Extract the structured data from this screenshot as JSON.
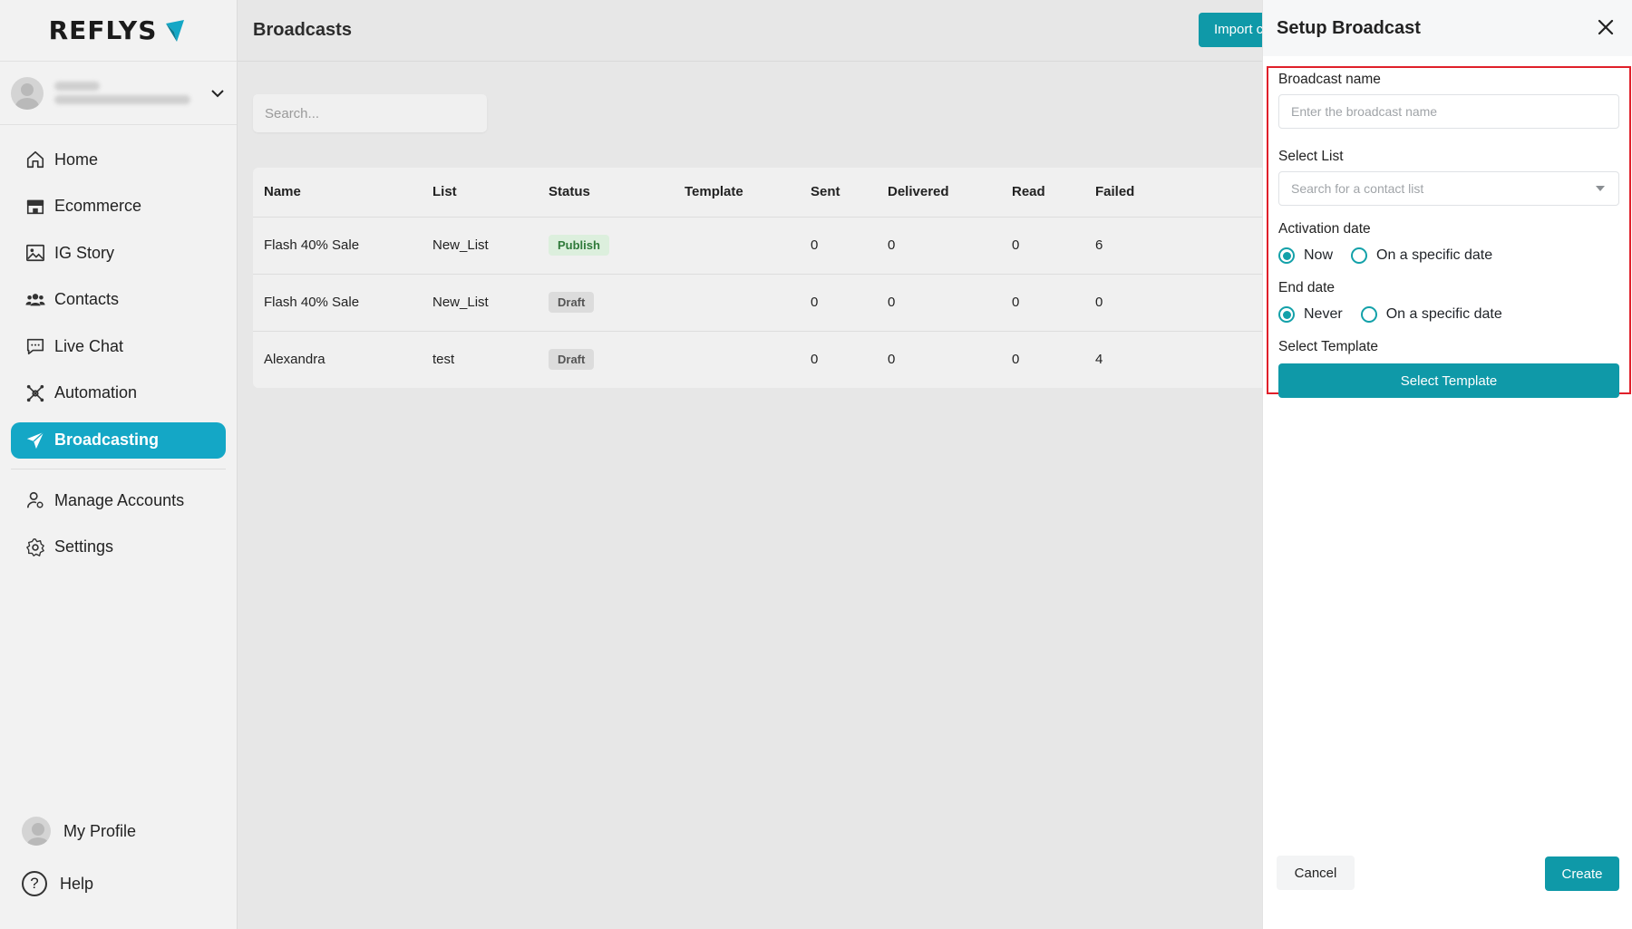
{
  "app": {
    "logo_text": "REFLYS"
  },
  "sidebar": {
    "items": [
      {
        "label": "Home",
        "icon": "home-icon"
      },
      {
        "label": "Ecommerce",
        "icon": "store-icon"
      },
      {
        "label": "IG Story",
        "icon": "image-icon"
      },
      {
        "label": "Contacts",
        "icon": "users-icon"
      },
      {
        "label": "Live Chat",
        "icon": "chat-icon"
      },
      {
        "label": "Automation",
        "icon": "automation-icon"
      },
      {
        "label": "Broadcasting",
        "icon": "send-icon",
        "active": true
      }
    ],
    "secondary": [
      {
        "label": "Manage Accounts",
        "icon": "user-manage-icon"
      },
      {
        "label": "Settings",
        "icon": "gear-icon"
      }
    ],
    "bottom": {
      "profile_label": "My Profile",
      "help_label": "Help",
      "help_glyph": "?"
    }
  },
  "main": {
    "title": "Broadcasts",
    "import_label": "Import c",
    "search_placeholder": "Search...",
    "table": {
      "columns": [
        "Name",
        "List",
        "Status",
        "Template",
        "Sent",
        "Delivered",
        "Read",
        "Failed"
      ],
      "rows": [
        {
          "name": "Flash 40% Sale",
          "list": "New_List",
          "status": "Publish",
          "template": "",
          "sent": "0",
          "delivered": "0",
          "read": "0",
          "failed": "6"
        },
        {
          "name": "Flash 40% Sale",
          "list": "New_List",
          "status": "Draft",
          "template": "",
          "sent": "0",
          "delivered": "0",
          "read": "0",
          "failed": "0"
        },
        {
          "name": "Alexandra",
          "list": "test",
          "status": "Draft",
          "template": "",
          "sent": "0",
          "delivered": "0",
          "read": "0",
          "failed": "4"
        }
      ]
    }
  },
  "panel": {
    "title": "Setup Broadcast",
    "broadcast_name_label": "Broadcast name",
    "broadcast_name_placeholder": "Enter the broadcast name",
    "select_list_label": "Select List",
    "select_list_placeholder": "Search for a contact list",
    "activation_label": "Activation date",
    "activation_options": [
      "Now",
      "On a specific date"
    ],
    "end_label": "End date",
    "end_options": [
      "Never",
      "On a specific date"
    ],
    "template_label": "Select Template",
    "template_button": "Select Template",
    "cancel_label": "Cancel",
    "create_label": "Create"
  },
  "colors": {
    "accent": "#14a7c6",
    "primary_button": "#0f99a8",
    "highlight_border": "#e0202a",
    "publish_bg": "#dcefdd"
  }
}
